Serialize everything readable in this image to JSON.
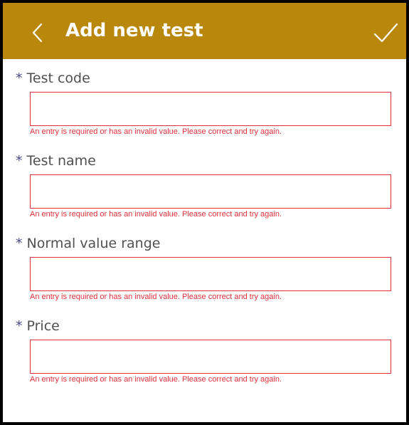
{
  "header": {
    "title": "Add new test",
    "back_icon": "chevron-left-icon",
    "save_icon": "checkmark-icon",
    "background_color": "#B8870B"
  },
  "form": {
    "required_marker": "*",
    "error_color": "#E0303A",
    "fields": [
      {
        "label": "Test code",
        "value": "",
        "error": "An entry is required or has an invalid value. Please correct and try again."
      },
      {
        "label": "Test name",
        "value": "",
        "error": "An entry is required or has an invalid value. Please correct and try again."
      },
      {
        "label": "Normal value range",
        "value": "",
        "error": "An entry is required or has an invalid value. Please correct and try again."
      },
      {
        "label": "Price",
        "value": "",
        "error": "An entry is required or has an invalid value. Please correct and try again."
      }
    ]
  }
}
